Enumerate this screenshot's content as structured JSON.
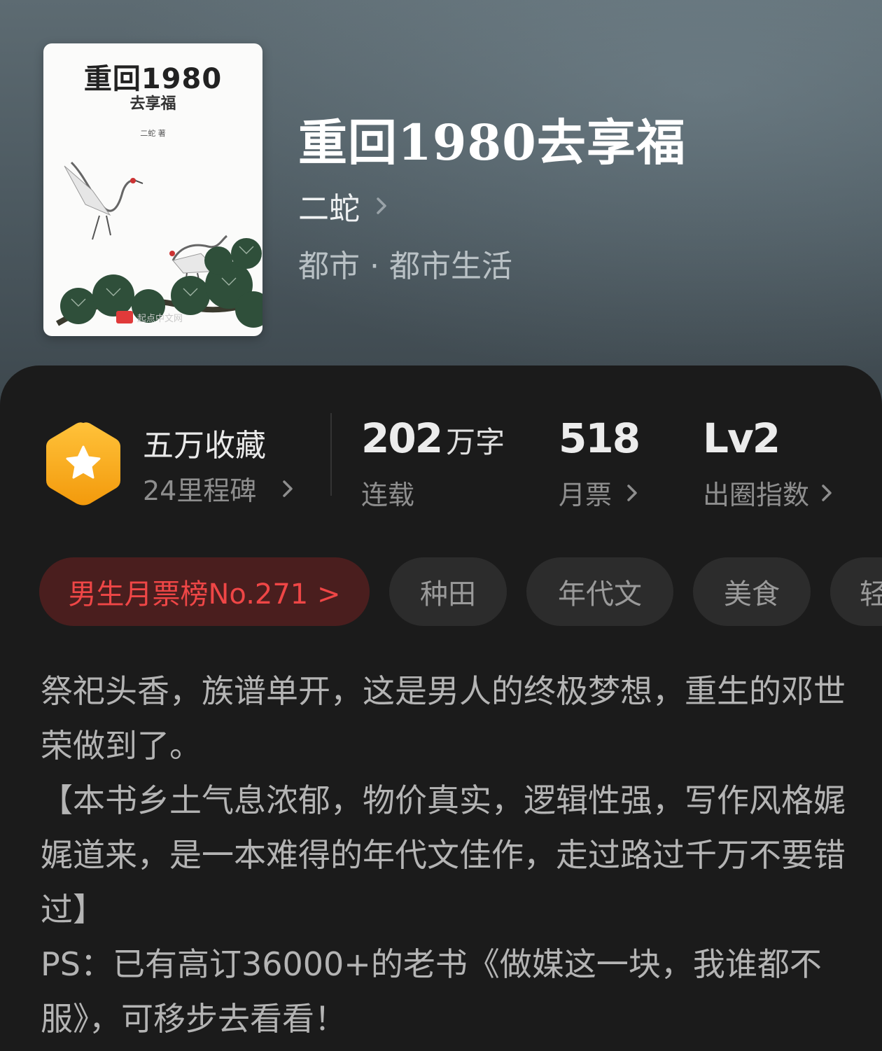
{
  "cover": {
    "title": "重回1980",
    "subtitle": "去享福",
    "author": "二蛇 著",
    "publisher_mark": "起点中文网"
  },
  "book": {
    "title": "重回1980去享福",
    "author": "二蛇",
    "genre": "都市 · 都市生活"
  },
  "stats": {
    "favorites_main": "五万收藏",
    "favorites_sub": "24里程碑",
    "words_number": "202",
    "words_unit": "万字",
    "status": "连载",
    "monthly_votes": "518",
    "monthly_votes_label": "月票",
    "level": "Lv2",
    "level_label": "出圈指数"
  },
  "tags": {
    "rank": "男生月票榜No.271 >",
    "items": [
      "种田",
      "年代文",
      "美食",
      "轻"
    ]
  },
  "description": [
    "祭祀头香，族谱单开，这是男人的终极梦想，重生的邓世荣做到了。",
    "【本书乡土气息浓郁，物价真实，逻辑性强，写作风格娓娓道来，是一本难得的年代文佳作，走过路过千万不要错过】",
    "PS：已有高订36000+的老书《做媒这一块，我谁都不服》，可移步去看看！"
  ],
  "colors": {
    "accent_red": "#ef4646",
    "badge_orange": "#f7a618",
    "panel_bg": "#1b1b1b"
  }
}
